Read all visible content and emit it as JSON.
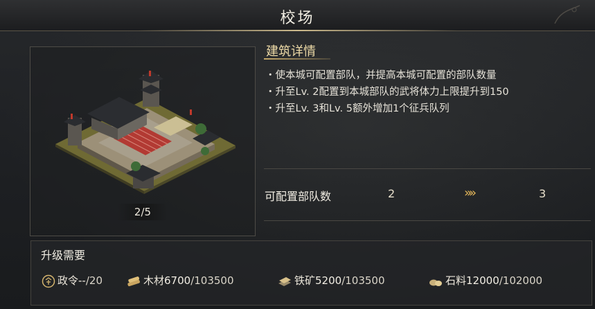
{
  "window": {
    "title": "校场"
  },
  "building": {
    "level": "2/5"
  },
  "details": {
    "heading": "建筑详情",
    "lines": [
      "・使本城可配置部队，并提高本城可配置的部队数量",
      "・升至Lv. 2配置到本城部队的武将体力上限提升到150",
      "・升至Lv. 3和Lv. 5额外增加1个征兵队列"
    ]
  },
  "stat": {
    "label": "可配置部队数",
    "current": "2",
    "arrow": "»",
    "next": "3"
  },
  "requirements": {
    "title": "升级需要",
    "items": [
      {
        "icon": "decree-icon",
        "name": "政令",
        "current": "--",
        "max": "/20"
      },
      {
        "icon": "wood-icon",
        "name": "木材",
        "current": "6700",
        "max": "/103500"
      },
      {
        "icon": "iron-icon",
        "name": "铁矿",
        "current": "5200",
        "max": "/103500"
      },
      {
        "icon": "stone-icon",
        "name": "石料",
        "current": "12000",
        "max": "/102000"
      }
    ]
  },
  "colors": {
    "accent": "#e6b85a",
    "heading": "#ecd9a6"
  }
}
